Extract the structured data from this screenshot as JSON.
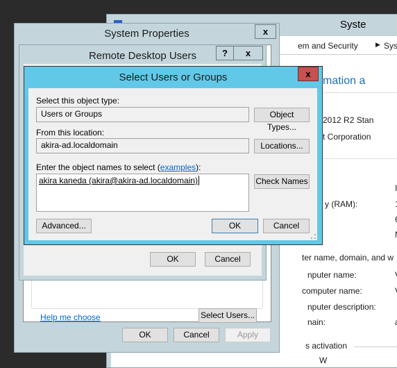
{
  "system_window": {
    "title": "Syste",
    "breadcrumb": [
      "em and Security",
      "Syste"
    ],
    "heading": "mation a",
    "edition": "2012 R2 Stan",
    "copyright": "t Corporation",
    "rows": [
      {
        "label": "",
        "value": "I"
      },
      {
        "label": "y (RAM):",
        "value": "1"
      },
      {
        "label": "",
        "value": "6"
      },
      {
        "label": "",
        "value": "N"
      }
    ],
    "section_name": "ter name, domain, and w",
    "name_rows": [
      {
        "label": "nputer name:",
        "value": "V"
      },
      {
        "label": "computer name:",
        "value": "V"
      },
      {
        "label": "nputer description:",
        "value": ""
      },
      {
        "label": "nain:",
        "value": "a"
      }
    ],
    "activation": "s activation",
    "activation_text": "W"
  },
  "system_properties": {
    "title": "System Properties",
    "close": "x",
    "help_link": "Help me choose",
    "select_users": "Select Users...",
    "ok": "OK",
    "cancel": "Cancel",
    "apply": "Apply"
  },
  "remote_desktop_users": {
    "title": "Remote Desktop Users",
    "help": "?",
    "close": "x",
    "ok": "OK",
    "cancel": "Cancel"
  },
  "select_users": {
    "title": "Select Users or Groups",
    "close": "x",
    "object_type_label": "Select this object type:",
    "object_type_value": "Users or Groups",
    "object_types_button": "Object Types...",
    "location_label": "From this location:",
    "location_value": "akira-ad.localdomain",
    "locations_button": "Locations...",
    "names_label_prefix": "Enter the object names to select (",
    "names_label_link": "examples",
    "names_label_suffix": "):",
    "names_value": "akira kaneda (akira@akira-ad.localdomain)",
    "check_names_button": "Check Names",
    "advanced_button": "Advanced...",
    "ok": "OK",
    "cancel": "Cancel"
  }
}
